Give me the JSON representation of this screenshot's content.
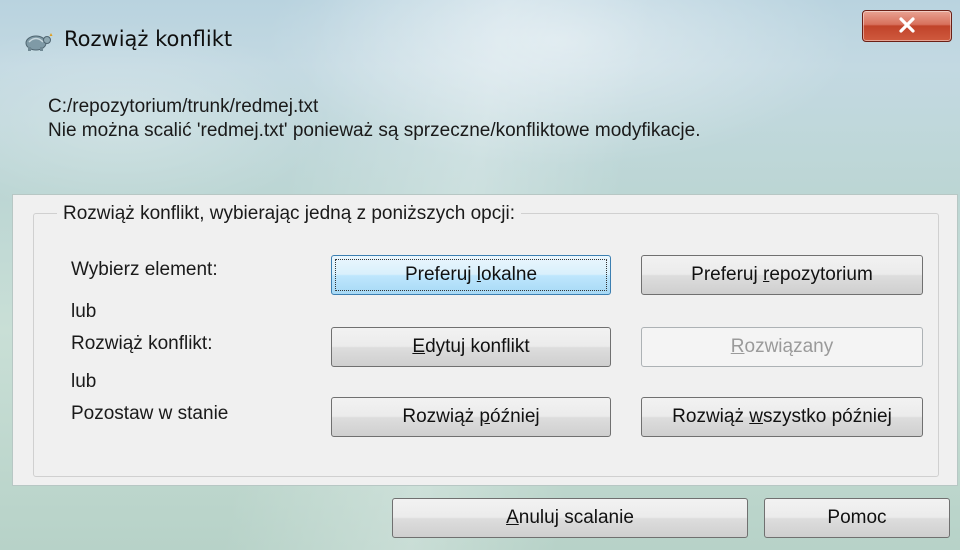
{
  "window": {
    "title": "Rozwiąż konflikt",
    "close_label": "x"
  },
  "info": {
    "path": "C:/repozytorium/trunk/redmej.txt",
    "message": "Nie można scalić 'redmej.txt' ponieważ są sprzeczne/konfliktowe modyfikacje."
  },
  "group": {
    "legend": "Rozwiąż konflikt, wybierając jedną z poniższych opcji:",
    "row1_label": "Wybierz element:",
    "or1": "lub",
    "row2_label": "Rozwiąż konflikt:",
    "or2": "lub",
    "row3_label": "Pozostaw w stanie"
  },
  "buttons": {
    "prefer_local": {
      "pre": "Preferuj ",
      "accel": "l",
      "post": "okalne"
    },
    "prefer_repo": {
      "pre": "Preferuj ",
      "accel": "r",
      "post": "epozytorium"
    },
    "edit_conflict": {
      "pre": "",
      "accel": "E",
      "post": "dytuj konflikt"
    },
    "resolved": {
      "pre": "",
      "accel": "R",
      "post": "ozwiązany"
    },
    "resolve_later": {
      "pre": "Rozwiąż ",
      "accel": "p",
      "post": "óźniej"
    },
    "resolve_all_later": {
      "pre": "Rozwiąż ",
      "accel": "w",
      "post": "szystko później"
    },
    "abort_merge": {
      "pre": "",
      "accel": "A",
      "post": "nuluj scalanie"
    },
    "help": {
      "pre": "",
      "accel": "",
      "post": "Pomoc"
    }
  },
  "icons": {
    "app": "tortoise-icon",
    "close": "close-icon"
  },
  "colors": {
    "close_button": "#c9533a",
    "focused_button": "#bee6fd",
    "disabled_text": "#9a9a9a"
  }
}
